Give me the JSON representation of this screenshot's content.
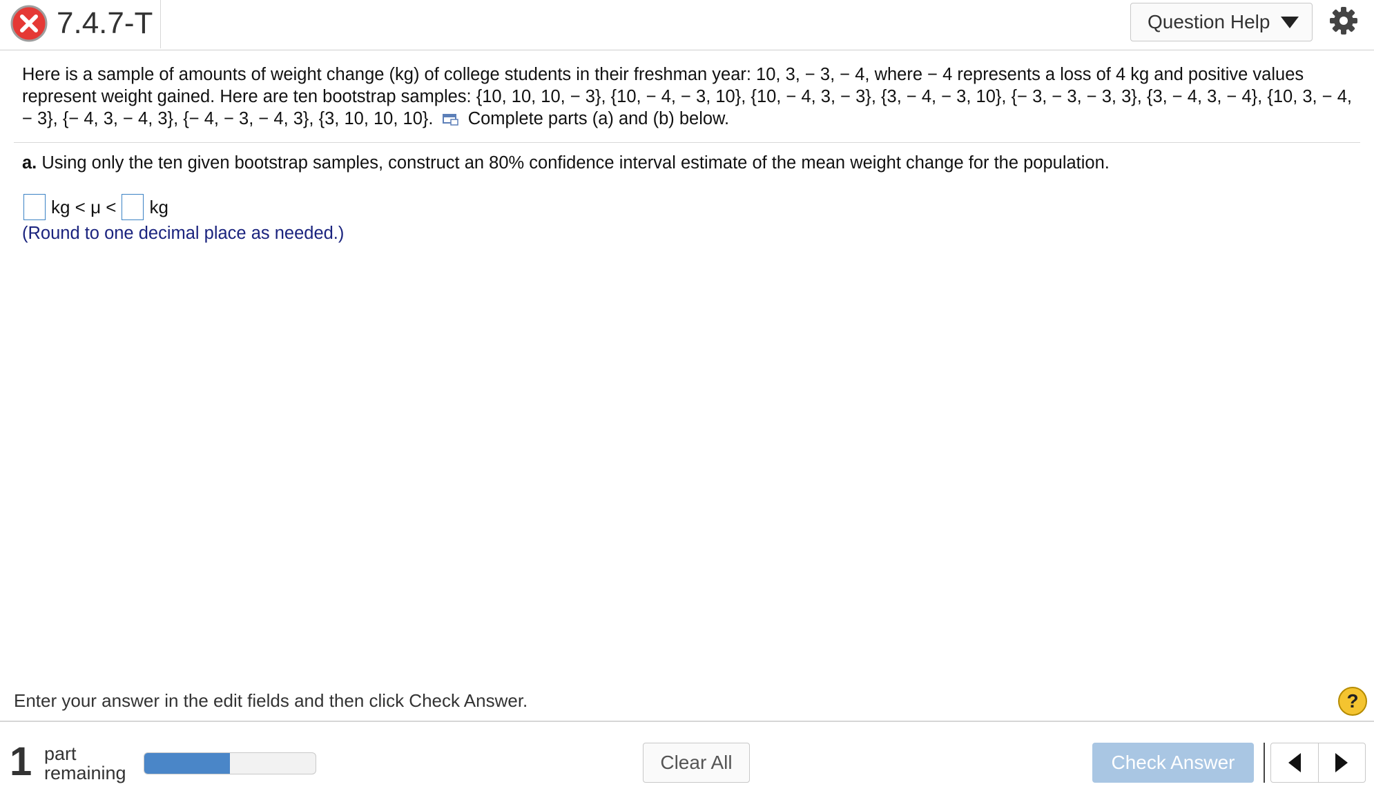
{
  "header": {
    "question_id": "7.4.7-T",
    "question_help_label": "Question Help",
    "status_icon": "x-circle-icon",
    "settings_icon": "gear-icon"
  },
  "problem": {
    "text": "Here is a sample of amounts of weight change (kg) of college students in their freshman year: 10, 3, − 3, − 4, where − 4 represents a loss of 4 kg and positive values represent weight gained. Here are ten bootstrap samples: {10, 10, 10, − 3}, {10, − 4, − 3, 10}, {10, − 4, 3, − 3}, {3, − 4, − 3, 10}, {− 3, − 3, − 3, 3}, {3, − 4, 3, − 4}, {10, 3, − 4, − 3}, {− 4, 3, − 4, 3}, {− 4, − 3, − 4, 3}, {3, 10, 10, 10}.",
    "instruction": "Complete parts (a) and (b) below."
  },
  "part_a": {
    "label": "a.",
    "text": "Using only the ten given bootstrap samples, construct an 80% confidence interval estimate of the mean weight change for the population."
  },
  "answer": {
    "middle_text": "kg < μ <",
    "unit_text": "kg",
    "lower_value": "",
    "upper_value": "",
    "hint": "(Round to one decimal place as needed.)"
  },
  "footer": {
    "instruction": "Enter your answer in the edit fields and then click Check Answer.",
    "help_label": "?",
    "parts_remaining_number": "1",
    "parts_remaining_line1": "part",
    "parts_remaining_line2": "remaining",
    "progress_fraction": 0.5,
    "clear_all_label": "Clear All",
    "check_answer_label": "Check Answer"
  },
  "colors": {
    "progress_fill": "#4a86c8",
    "check_button": "#a9c6e3",
    "hint_text": "#1a237e",
    "error_icon": "#d32f2f"
  }
}
